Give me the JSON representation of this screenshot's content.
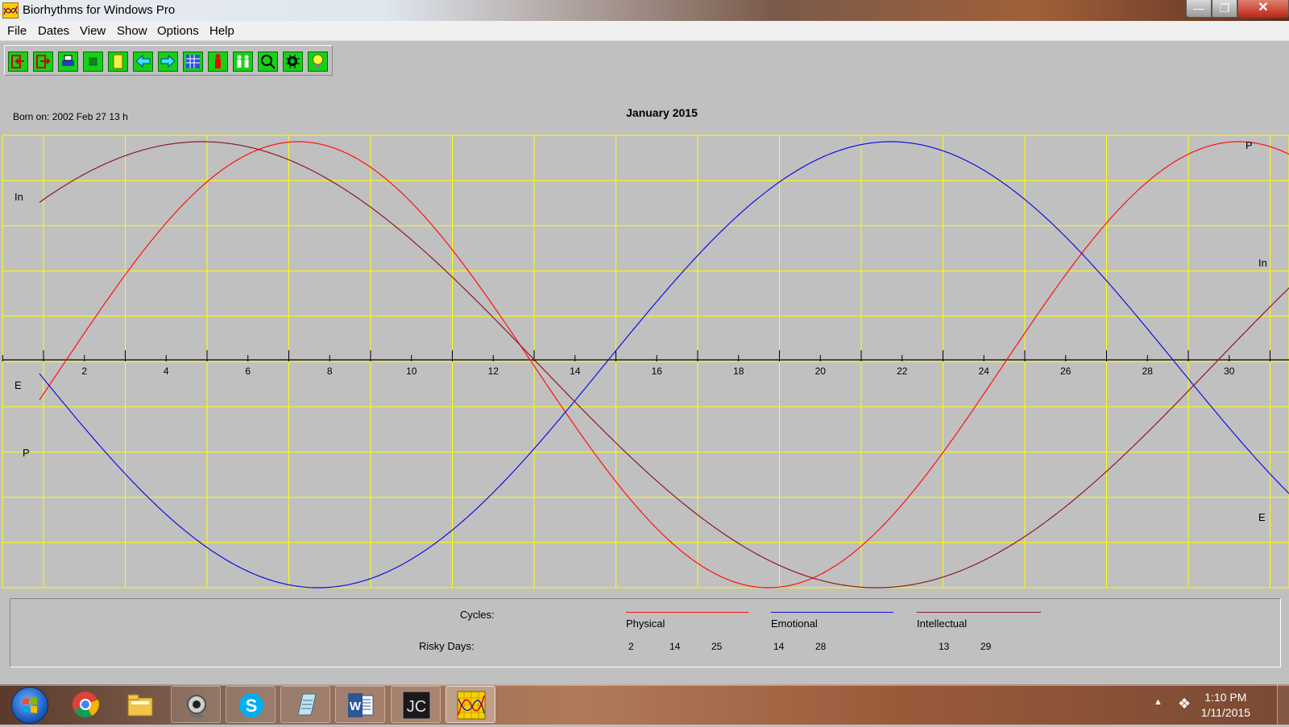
{
  "window": {
    "title": "Biorhythms for Windows Pro"
  },
  "menu": [
    "File",
    "Dates",
    "View",
    "Show",
    "Options",
    "Help"
  ],
  "toolbar": {
    "buttons": [
      "open-icon",
      "export-icon",
      "print-icon",
      "zoom-icon",
      "notes-icon",
      "prev-arrow-icon",
      "next-arrow-icon",
      "calendar-icon",
      "person-icon",
      "compare-people-icon",
      "search-icon",
      "find-date-icon",
      "tip-icon"
    ]
  },
  "header": {
    "born": "Born on: 2002 Feb 27  13 h",
    "month": "January 2015"
  },
  "curve_labels": {
    "in_left": "In",
    "e_left": "E",
    "p_left": "P",
    "p_right": "P",
    "in_right": "In",
    "e_right": "E"
  },
  "legend": {
    "cycles_label": "Cycles:",
    "risky_label": "Risky Days:",
    "physical": {
      "name": "Physical",
      "color": "#ff1010",
      "risky": [
        "2",
        "14",
        "25"
      ]
    },
    "emotional": {
      "name": "Emotional",
      "color": "#1010e0",
      "risky": [
        "14",
        "28"
      ]
    },
    "intellectual": {
      "name": "Intellectual",
      "color": "#8a1a2a",
      "risky": [
        "13",
        "29"
      ]
    }
  },
  "taskbar": {
    "icons": [
      "windows-start-icon",
      "chrome-icon",
      "file-explorer-icon",
      "webcam-icon",
      "skype-icon",
      "notepad-icon",
      "word-icon",
      "jc-app-icon",
      "biorhythms-app-icon"
    ],
    "time": "1:10 PM",
    "date": "1/11/2015"
  },
  "chart_data": {
    "type": "line",
    "title": "January 2015",
    "x_range": [
      1,
      31
    ],
    "y_range": [
      -1,
      1
    ],
    "x_tick_labels": [
      "2",
      "4",
      "6",
      "8",
      "10",
      "12",
      "14",
      "16",
      "18",
      "20",
      "22",
      "24",
      "26",
      "28",
      "30"
    ],
    "grid": true,
    "series": [
      {
        "name": "Physical",
        "color": "#ff1010",
        "period_days": 23,
        "x": [
          1,
          2,
          4,
          6,
          8,
          9,
          11,
          13,
          14,
          16,
          18,
          20,
          22,
          24,
          25,
          27,
          29,
          31
        ],
        "y": [
          -0.4,
          -0.14,
          0.52,
          0.94,
          0.98,
          0.94,
          0.52,
          -0.14,
          -0.4,
          -0.84,
          -1.0,
          -0.94,
          -0.63,
          -0.07,
          0.27,
          0.82,
          1.0,
          0.91
        ]
      },
      {
        "name": "Emotional",
        "color": "#1010e0",
        "period_days": 28,
        "x": [
          1,
          3,
          5,
          7,
          8,
          9,
          11,
          13,
          14,
          15,
          17,
          19,
          21,
          22,
          23,
          25,
          27,
          29,
          31
        ],
        "y": [
          -0.1,
          -0.5,
          -0.85,
          -1.0,
          -1.0,
          -0.96,
          -0.77,
          -0.43,
          -0.22,
          0.0,
          0.43,
          0.78,
          1.0,
          1.0,
          0.95,
          0.74,
          0.4,
          -0.07,
          -0.72
        ]
      },
      {
        "name": "Intellectual",
        "color": "#8a1a2a",
        "period_days": 33,
        "x": [
          1,
          3,
          5,
          7,
          9,
          11,
          13,
          15,
          17,
          19,
          21,
          22,
          23,
          25,
          27,
          29,
          31
        ],
        "y": [
          0.71,
          0.94,
          1.0,
          0.91,
          0.69,
          0.37,
          0.0,
          -0.37,
          -0.69,
          -0.91,
          -1.0,
          -1.0,
          -0.98,
          -0.84,
          -0.58,
          -0.19,
          0.41
        ]
      }
    ]
  }
}
